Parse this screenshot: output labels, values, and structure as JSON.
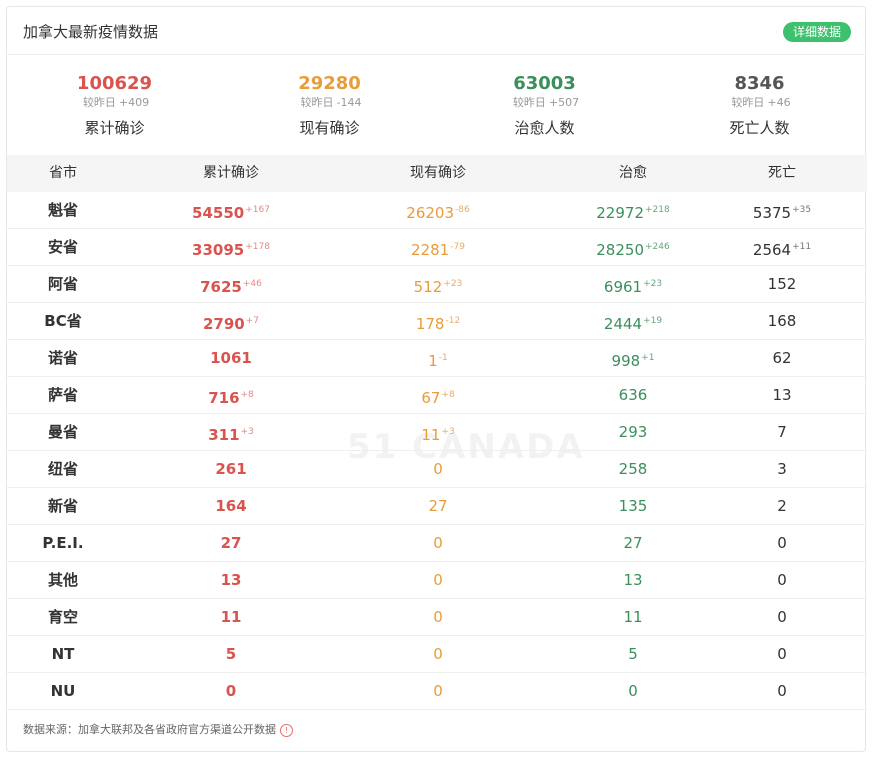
{
  "header": {
    "title": "加拿大最新疫情数据",
    "detail_button": "详细数据"
  },
  "colors": {
    "red": "#d9534f",
    "orange": "#e89c3a",
    "green": "#3a8f5c",
    "dark": "#333333",
    "button": "#3ec16e"
  },
  "summary": [
    {
      "value": "100629",
      "delta_label": "较昨日",
      "delta": "+409",
      "label": "累计确诊",
      "color": "#d9534f"
    },
    {
      "value": "29280",
      "delta_label": "较昨日",
      "delta": "-144",
      "label": "现有确诊",
      "color": "#e89c3a"
    },
    {
      "value": "63003",
      "delta_label": "较昨日",
      "delta": "+507",
      "label": "治愈人数",
      "color": "#3a8f5c"
    },
    {
      "value": "8346",
      "delta_label": "较昨日",
      "delta": "+46",
      "label": "死亡人数",
      "color": "#555555"
    }
  ],
  "table": {
    "headers": [
      "省市",
      "累计确诊",
      "现有确诊",
      "治愈",
      "死亡"
    ],
    "rows": [
      {
        "prov": "魁省",
        "confirmed": "54550",
        "confirmed_inc": "+167",
        "current": "26203",
        "current_inc": "-86",
        "cured": "22972",
        "cured_inc": "+218",
        "dead": "5375",
        "dead_inc": "+35"
      },
      {
        "prov": "安省",
        "confirmed": "33095",
        "confirmed_inc": "+178",
        "current": "2281",
        "current_inc": "-79",
        "cured": "28250",
        "cured_inc": "+246",
        "dead": "2564",
        "dead_inc": "+11"
      },
      {
        "prov": "阿省",
        "confirmed": "7625",
        "confirmed_inc": "+46",
        "current": "512",
        "current_inc": "+23",
        "cured": "6961",
        "cured_inc": "+23",
        "dead": "152",
        "dead_inc": ""
      },
      {
        "prov": "BC省",
        "confirmed": "2790",
        "confirmed_inc": "+7",
        "current": "178",
        "current_inc": "-12",
        "cured": "2444",
        "cured_inc": "+19",
        "dead": "168",
        "dead_inc": ""
      },
      {
        "prov": "诺省",
        "confirmed": "1061",
        "confirmed_inc": "",
        "current": "1",
        "current_inc": "-1",
        "cured": "998",
        "cured_inc": "+1",
        "dead": "62",
        "dead_inc": ""
      },
      {
        "prov": "萨省",
        "confirmed": "716",
        "confirmed_inc": "+8",
        "current": "67",
        "current_inc": "+8",
        "cured": "636",
        "cured_inc": "",
        "dead": "13",
        "dead_inc": ""
      },
      {
        "prov": "曼省",
        "confirmed": "311",
        "confirmed_inc": "+3",
        "current": "11",
        "current_inc": "+3",
        "cured": "293",
        "cured_inc": "",
        "dead": "7",
        "dead_inc": ""
      },
      {
        "prov": "纽省",
        "confirmed": "261",
        "confirmed_inc": "",
        "current": "0",
        "current_inc": "",
        "cured": "258",
        "cured_inc": "",
        "dead": "3",
        "dead_inc": ""
      },
      {
        "prov": "新省",
        "confirmed": "164",
        "confirmed_inc": "",
        "current": "27",
        "current_inc": "",
        "cured": "135",
        "cured_inc": "",
        "dead": "2",
        "dead_inc": ""
      },
      {
        "prov": "P.E.I.",
        "confirmed": "27",
        "confirmed_inc": "",
        "current": "0",
        "current_inc": "",
        "cured": "27",
        "cured_inc": "",
        "dead": "0",
        "dead_inc": ""
      },
      {
        "prov": "其他",
        "confirmed": "13",
        "confirmed_inc": "",
        "current": "0",
        "current_inc": "",
        "cured": "13",
        "cured_inc": "",
        "dead": "0",
        "dead_inc": ""
      },
      {
        "prov": "育空",
        "confirmed": "11",
        "confirmed_inc": "",
        "current": "0",
        "current_inc": "",
        "cured": "11",
        "cured_inc": "",
        "dead": "0",
        "dead_inc": ""
      },
      {
        "prov": "NT",
        "confirmed": "5",
        "confirmed_inc": "",
        "current": "0",
        "current_inc": "",
        "cured": "5",
        "cured_inc": "",
        "dead": "0",
        "dead_inc": ""
      },
      {
        "prov": "NU",
        "confirmed": "0",
        "confirmed_inc": "",
        "current": "0",
        "current_inc": "",
        "cured": "0",
        "cured_inc": "",
        "dead": "0",
        "dead_inc": ""
      }
    ]
  },
  "footer": {
    "source": "数据来源：加拿大联邦及各省政府官方渠道公开数据",
    "icon": "info-icon"
  },
  "watermark": "51 CANADA"
}
